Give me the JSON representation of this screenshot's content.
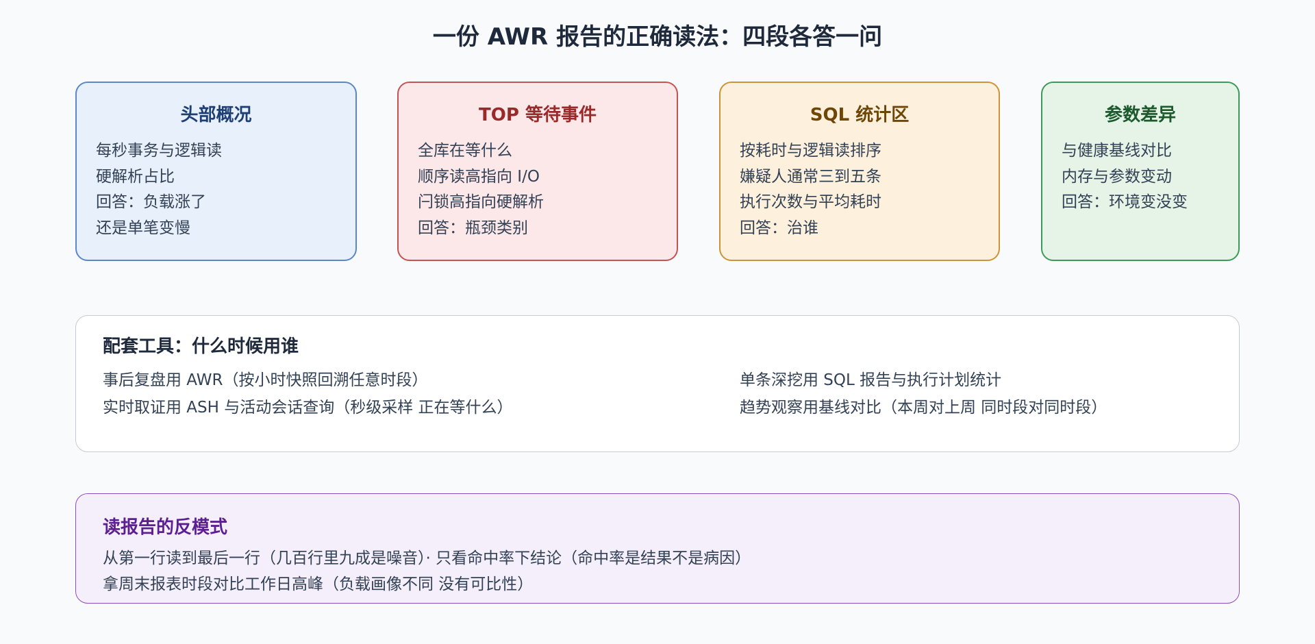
{
  "title": "一份 AWR 报告的正确读法：四段各答一问",
  "cards": [
    {
      "title": "头部概况",
      "lines": [
        "每秒事务与逻辑读",
        "硬解析占比",
        "回答：负载涨了",
        "还是单笔变慢"
      ]
    },
    {
      "title": "TOP 等待事件",
      "lines": [
        "全库在等什么",
        "顺序读高指向 I/O",
        "闩锁高指向硬解析",
        "回答：瓶颈类别"
      ]
    },
    {
      "title": "SQL 统计区",
      "lines": [
        "按耗时与逻辑读排序",
        "嫌疑人通常三到五条",
        "执行次数与平均耗时",
        "回答：治谁"
      ]
    },
    {
      "title": "参数差异",
      "lines": [
        "与健康基线对比",
        "内存与参数变动",
        "回答：环境变没变"
      ]
    }
  ],
  "tools": {
    "title": "配套工具：什么时候用谁",
    "items": [
      "事后复盘用 AWR（按小时快照回溯任意时段）",
      "实时取证用 ASH 与活动会话查询（秒级采样 正在等什么）",
      "单条深挖用 SQL 报告与执行计划统计",
      "趋势观察用基线对比（本周对上周 同时段对同时段）"
    ]
  },
  "anti_patterns": {
    "title": "读报告的反模式",
    "lines": [
      "从第一行读到最后一行（几百行里九成是噪音）· 只看命中率下结论（命中率是结果不是病因）",
      "拿周末报表时段对比工作日高峰（负载画像不同 没有可比性）"
    ]
  },
  "colors": {
    "header_blue": "#5b87c9",
    "wait_red": "#c55353",
    "sql_orange": "#cc9437",
    "param_green": "#3c9a58",
    "anti_purple": "#8a4fc2"
  }
}
